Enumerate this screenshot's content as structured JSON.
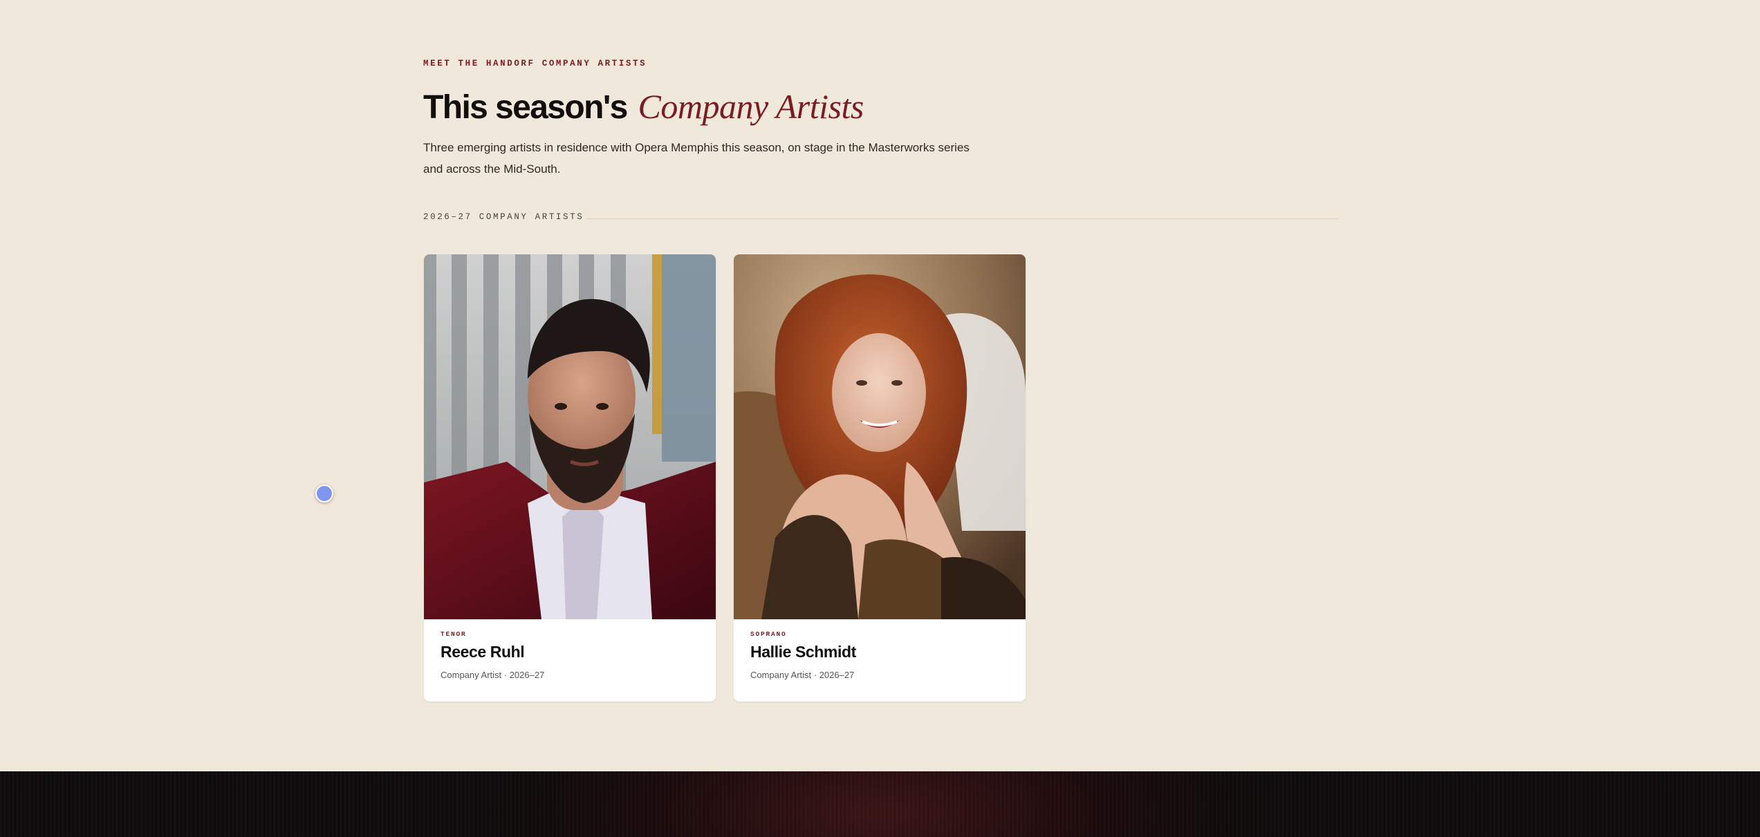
{
  "header": {
    "eyebrow": "MEET THE HANDORF COMPANY ARTISTS",
    "title_main": "This season's",
    "title_accent": "Company Artists",
    "intro": "Three emerging artists in residence with Opera Memphis this season, on stage in the Masterworks series and across the Mid-South."
  },
  "section": {
    "label": "2026–27 COMPANY ARTISTS"
  },
  "artists": [
    {
      "voice": "TENOR",
      "name": "Reece Ruhl",
      "meta": "Company Artist · 2026–27"
    },
    {
      "voice": "SOPRANO",
      "name": "Hallie Schmidt",
      "meta": "Company Artist · 2026–27"
    }
  ],
  "colors": {
    "background": "#f1e8dc",
    "accent": "#7a1c22",
    "ink": "#120e0c",
    "footer": "#0d0b0b"
  }
}
